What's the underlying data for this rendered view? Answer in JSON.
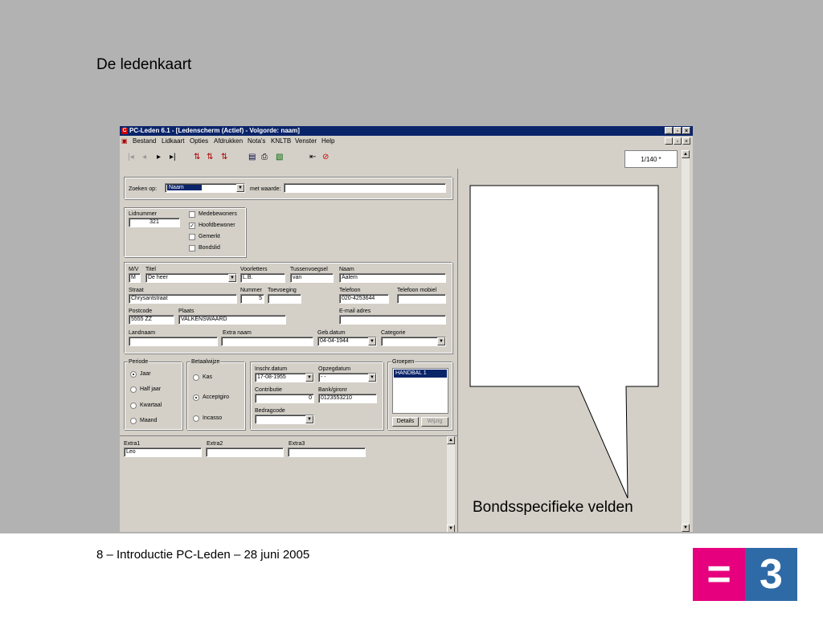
{
  "slide": {
    "title": "De ledenkaart",
    "footer": "8 – Introductie PC-Leden – 28 juni 2005",
    "callout": "Bondsspecifieke velden",
    "logo_left": "=",
    "logo_right": "3",
    "colors": {
      "background": "#b2b2b2",
      "logo_pink": "#e6007e",
      "logo_blue": "#2e6aa6"
    }
  },
  "app": {
    "title": "PC-Leden 6.1 - [Ledenscherm (Actief) - Volgorde: naam]",
    "menu": [
      "Bestand",
      "Lidkaart",
      "Opties",
      "Afdrukken",
      "Nota's",
      "KNLTB",
      "Venster",
      "Help"
    ],
    "counter": "1/140 *",
    "search": {
      "label": "Zoeken op:",
      "field": "Naam",
      "with_label": "met waarde:",
      "value": ""
    },
    "lid": {
      "number_label": "Lidnummer",
      "number": "321",
      "checkboxes": [
        {
          "label": "Medebewoners",
          "checked": false
        },
        {
          "label": "Hoofdbewoner",
          "checked": true
        },
        {
          "label": "Gemerkt",
          "checked": false
        },
        {
          "label": "Bondslid",
          "checked": false
        }
      ]
    },
    "person": {
      "mv_label": "M/V",
      "mv": "M",
      "titel_label": "Titel",
      "titel": "De heer",
      "voorletters_label": "Voorletters",
      "voorletters": "L.B.",
      "tussenvoegsel_label": "Tussenvoegsel",
      "tussenvoegsel": "van",
      "naam_label": "Naam",
      "naam": "Aalem",
      "straat_label": "Straat",
      "straat": "Chrysantstraat",
      "nummer_label": "Nummer",
      "nummer": "5",
      "toevoeging_label": "Toevoeging",
      "toevoeging": "",
      "telefoon_label": "Telefoon",
      "telefoon": "020-4253644",
      "telefoon_mobiel_label": "Telefoon mobiel",
      "telefoon_mobiel": "",
      "postcode_label": "Postcode",
      "postcode": "5555 ZZ",
      "plaats_label": "Plaats",
      "plaats": "VALKENSWAARD",
      "email_label": "E-mail adres",
      "email": "",
      "landnaam_label": "Landnaam",
      "landnaam": "",
      "extra_naam_label": "Extra naam",
      "extra_naam": "",
      "gebdatum_label": "Geb.datum",
      "gebdatum": "04-04-1944",
      "categorie_label": "Categorie",
      "categorie": ""
    },
    "periode": {
      "legend": "Periode",
      "options": [
        {
          "label": "Jaar",
          "selected": true
        },
        {
          "label": "Half jaar",
          "selected": false
        },
        {
          "label": "Kwartaal",
          "selected": false
        },
        {
          "label": "Maand",
          "selected": false
        }
      ]
    },
    "betaalwijze": {
      "legend": "Betaalwijze",
      "options": [
        {
          "label": "Kas",
          "selected": false
        },
        {
          "label": "Acceptgiro",
          "selected": true
        },
        {
          "label": "Incasso",
          "selected": false
        }
      ]
    },
    "finance": {
      "inschr_label": "Inschr.datum",
      "inschr": "17-08-1955",
      "opzeg_label": "Opzegdatum",
      "opzeg": " -  -",
      "contributie_label": "Contributie",
      "contributie": "0",
      "bank_label": "Bank/gironr",
      "bank": "0123553210",
      "bedragcode_label": "Bedragcode",
      "bedragcode": ""
    },
    "groepen": {
      "legend": "Groepen",
      "items": [
        "HANDBAL 1"
      ],
      "details_button": "Details",
      "wijzig_button": "Wijzig"
    },
    "extra": {
      "extra1_label": "Extra1",
      "extra1": "Leo",
      "extra2_label": "Extra2",
      "extra2": "",
      "extra3_label": "Extra3",
      "extra3": ""
    }
  }
}
